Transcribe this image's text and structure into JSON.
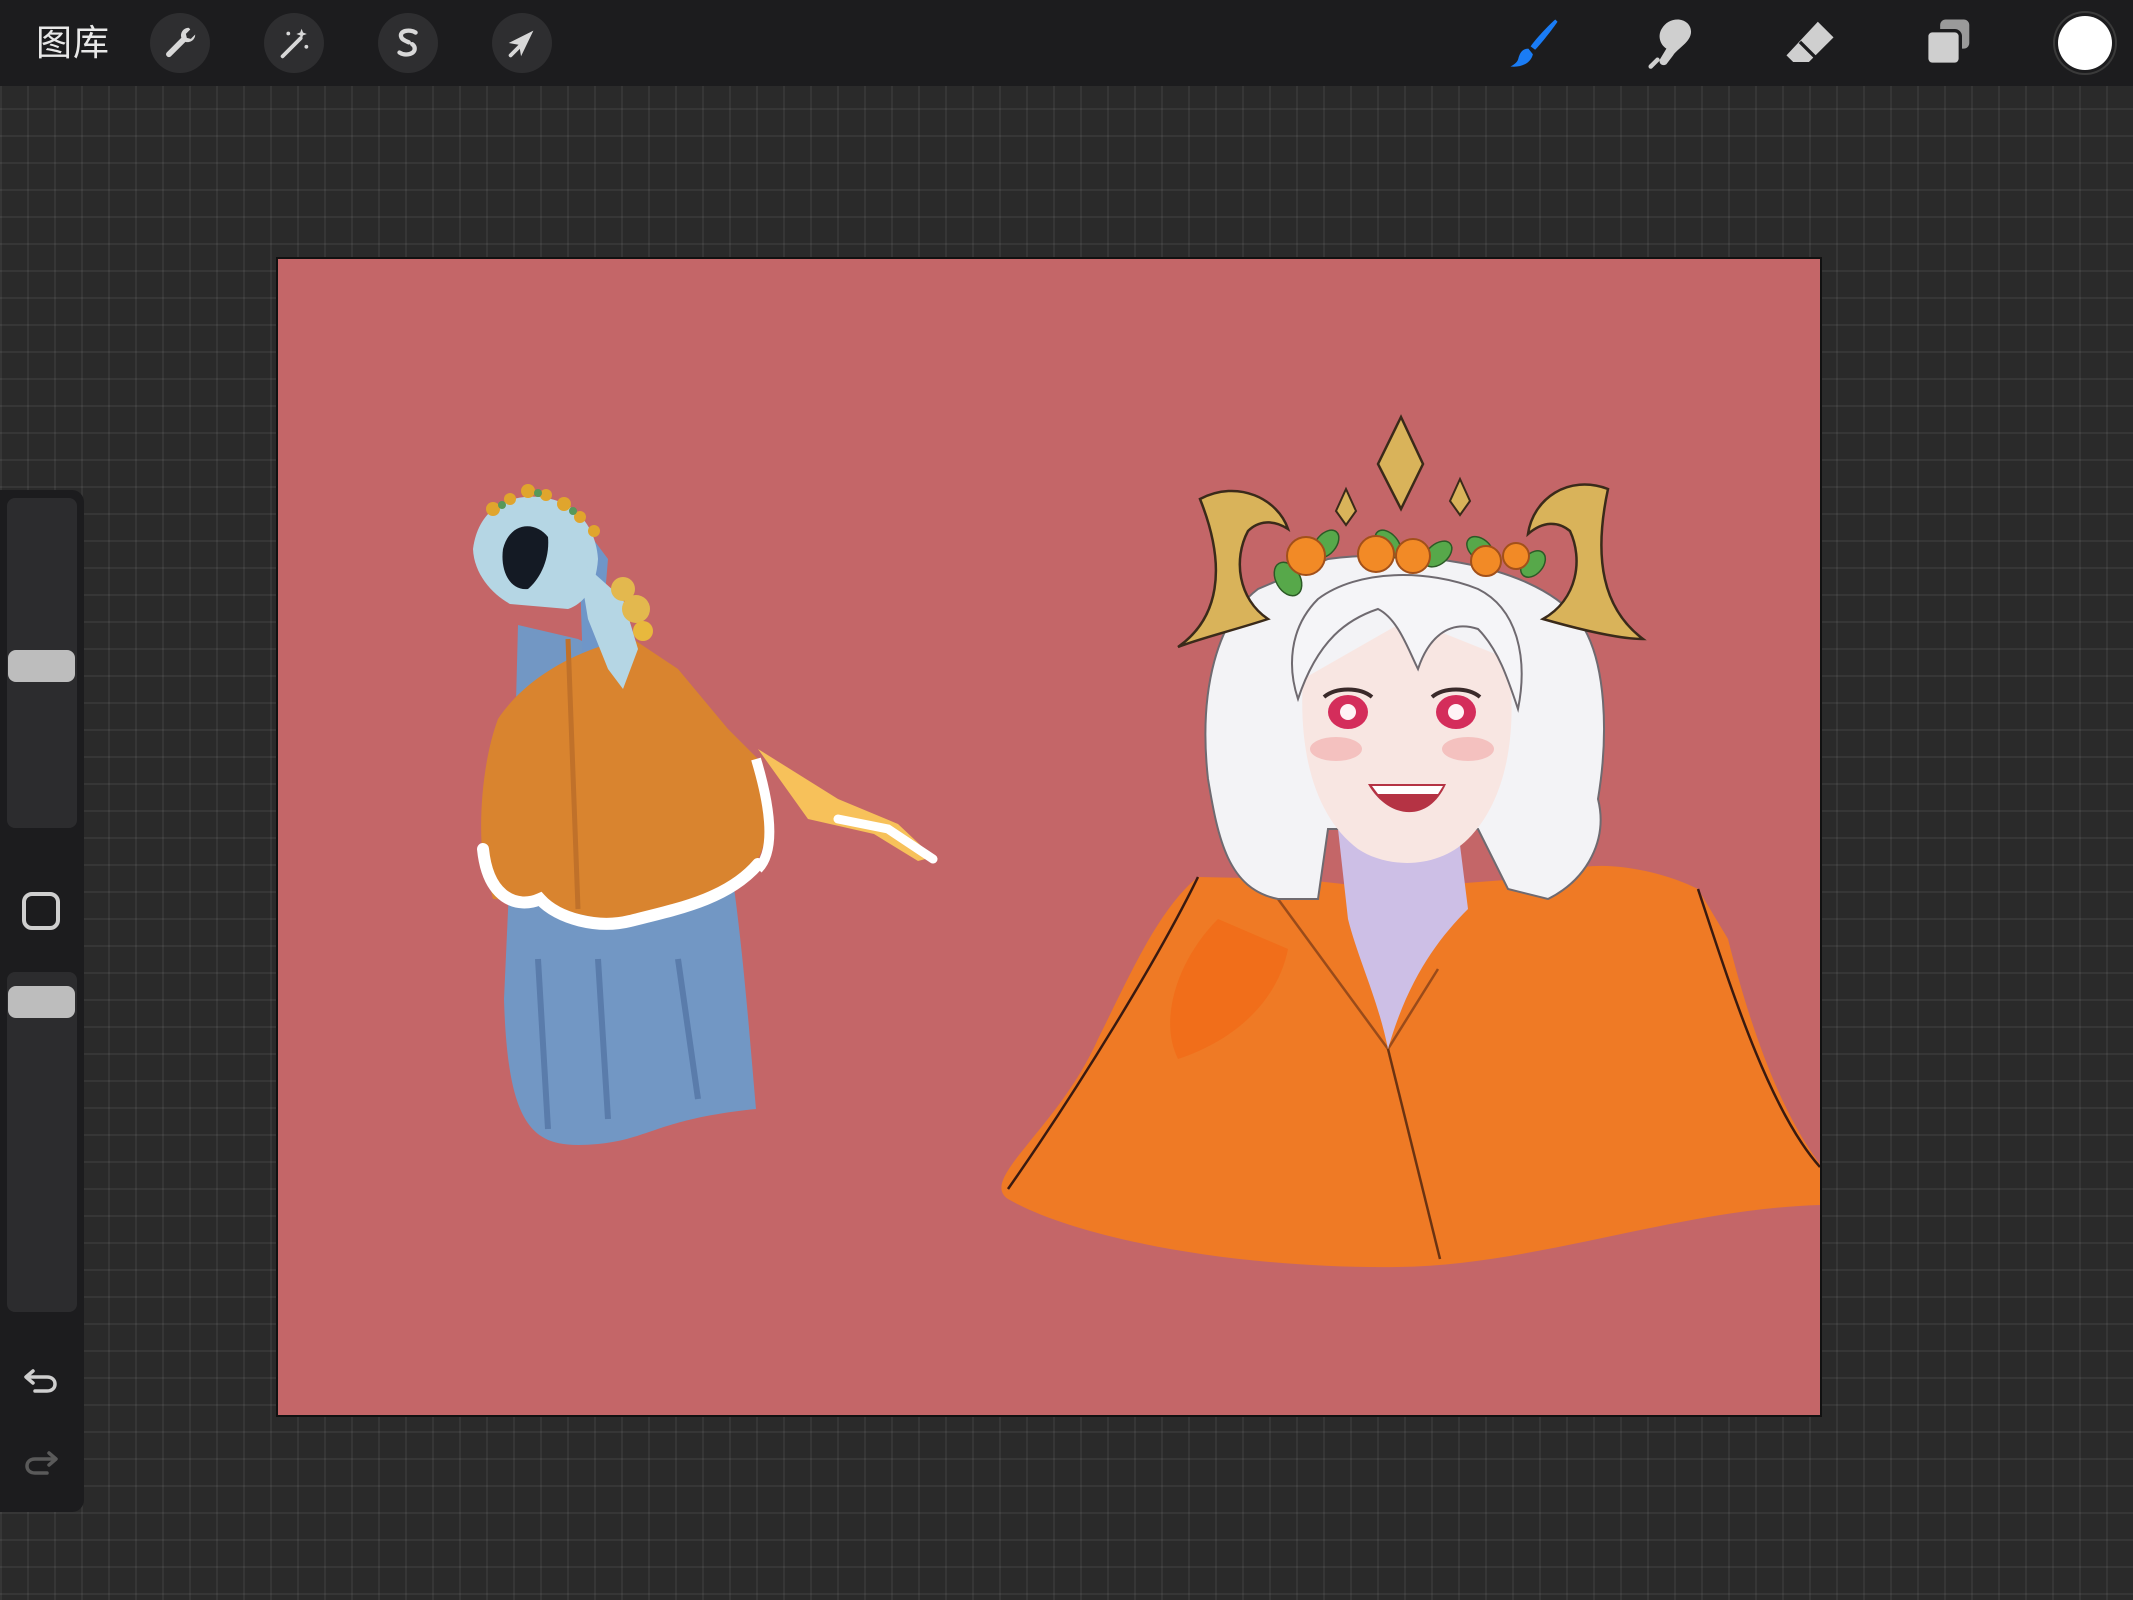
{
  "toolbar": {
    "gallery_label": "图库",
    "left_tools": [
      {
        "name": "actions",
        "icon": "wrench-icon"
      },
      {
        "name": "adjustments",
        "icon": "magic-wand-icon"
      },
      {
        "name": "selection",
        "icon": "selection-s-icon"
      },
      {
        "name": "transform",
        "icon": "arrow-cursor-icon"
      }
    ],
    "right_tools": [
      {
        "name": "paint",
        "icon": "brush-icon",
        "active": true
      },
      {
        "name": "smudge",
        "icon": "smudge-finger-icon",
        "active": false
      },
      {
        "name": "erase",
        "icon": "eraser-icon",
        "active": false
      },
      {
        "name": "layers",
        "icon": "layers-icon",
        "active": false
      }
    ],
    "current_color": "#ffffff",
    "active_tool_color": "#1a7cf5"
  },
  "sidebar": {
    "brush_size_icon": "size-slider",
    "modify_icon": "square-modify-icon",
    "opacity_icon": "opacity-slider",
    "undo_icon": "undo-icon",
    "redo_icon": "redo-icon"
  },
  "canvas": {
    "background_color": "#c46668",
    "cape_color": "#ef7a25",
    "hair_color": "#f3f3f6"
  }
}
